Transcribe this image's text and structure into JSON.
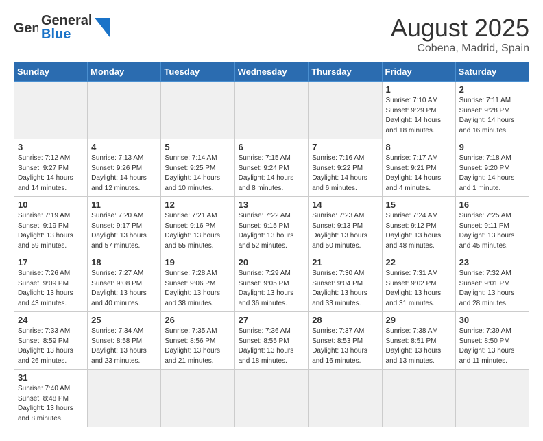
{
  "header": {
    "logo_general": "General",
    "logo_blue": "Blue",
    "month_title": "August 2025",
    "subtitle": "Cobena, Madrid, Spain"
  },
  "weekdays": [
    "Sunday",
    "Monday",
    "Tuesday",
    "Wednesday",
    "Thursday",
    "Friday",
    "Saturday"
  ],
  "weeks": [
    [
      {
        "day": "",
        "info": ""
      },
      {
        "day": "",
        "info": ""
      },
      {
        "day": "",
        "info": ""
      },
      {
        "day": "",
        "info": ""
      },
      {
        "day": "",
        "info": ""
      },
      {
        "day": "1",
        "info": "Sunrise: 7:10 AM\nSunset: 9:29 PM\nDaylight: 14 hours and 18 minutes."
      },
      {
        "day": "2",
        "info": "Sunrise: 7:11 AM\nSunset: 9:28 PM\nDaylight: 14 hours and 16 minutes."
      }
    ],
    [
      {
        "day": "3",
        "info": "Sunrise: 7:12 AM\nSunset: 9:27 PM\nDaylight: 14 hours and 14 minutes."
      },
      {
        "day": "4",
        "info": "Sunrise: 7:13 AM\nSunset: 9:26 PM\nDaylight: 14 hours and 12 minutes."
      },
      {
        "day": "5",
        "info": "Sunrise: 7:14 AM\nSunset: 9:25 PM\nDaylight: 14 hours and 10 minutes."
      },
      {
        "day": "6",
        "info": "Sunrise: 7:15 AM\nSunset: 9:24 PM\nDaylight: 14 hours and 8 minutes."
      },
      {
        "day": "7",
        "info": "Sunrise: 7:16 AM\nSunset: 9:22 PM\nDaylight: 14 hours and 6 minutes."
      },
      {
        "day": "8",
        "info": "Sunrise: 7:17 AM\nSunset: 9:21 PM\nDaylight: 14 hours and 4 minutes."
      },
      {
        "day": "9",
        "info": "Sunrise: 7:18 AM\nSunset: 9:20 PM\nDaylight: 14 hours and 1 minute."
      }
    ],
    [
      {
        "day": "10",
        "info": "Sunrise: 7:19 AM\nSunset: 9:19 PM\nDaylight: 13 hours and 59 minutes."
      },
      {
        "day": "11",
        "info": "Sunrise: 7:20 AM\nSunset: 9:17 PM\nDaylight: 13 hours and 57 minutes."
      },
      {
        "day": "12",
        "info": "Sunrise: 7:21 AM\nSunset: 9:16 PM\nDaylight: 13 hours and 55 minutes."
      },
      {
        "day": "13",
        "info": "Sunrise: 7:22 AM\nSunset: 9:15 PM\nDaylight: 13 hours and 52 minutes."
      },
      {
        "day": "14",
        "info": "Sunrise: 7:23 AM\nSunset: 9:13 PM\nDaylight: 13 hours and 50 minutes."
      },
      {
        "day": "15",
        "info": "Sunrise: 7:24 AM\nSunset: 9:12 PM\nDaylight: 13 hours and 48 minutes."
      },
      {
        "day": "16",
        "info": "Sunrise: 7:25 AM\nSunset: 9:11 PM\nDaylight: 13 hours and 45 minutes."
      }
    ],
    [
      {
        "day": "17",
        "info": "Sunrise: 7:26 AM\nSunset: 9:09 PM\nDaylight: 13 hours and 43 minutes."
      },
      {
        "day": "18",
        "info": "Sunrise: 7:27 AM\nSunset: 9:08 PM\nDaylight: 13 hours and 40 minutes."
      },
      {
        "day": "19",
        "info": "Sunrise: 7:28 AM\nSunset: 9:06 PM\nDaylight: 13 hours and 38 minutes."
      },
      {
        "day": "20",
        "info": "Sunrise: 7:29 AM\nSunset: 9:05 PM\nDaylight: 13 hours and 36 minutes."
      },
      {
        "day": "21",
        "info": "Sunrise: 7:30 AM\nSunset: 9:04 PM\nDaylight: 13 hours and 33 minutes."
      },
      {
        "day": "22",
        "info": "Sunrise: 7:31 AM\nSunset: 9:02 PM\nDaylight: 13 hours and 31 minutes."
      },
      {
        "day": "23",
        "info": "Sunrise: 7:32 AM\nSunset: 9:01 PM\nDaylight: 13 hours and 28 minutes."
      }
    ],
    [
      {
        "day": "24",
        "info": "Sunrise: 7:33 AM\nSunset: 8:59 PM\nDaylight: 13 hours and 26 minutes."
      },
      {
        "day": "25",
        "info": "Sunrise: 7:34 AM\nSunset: 8:58 PM\nDaylight: 13 hours and 23 minutes."
      },
      {
        "day": "26",
        "info": "Sunrise: 7:35 AM\nSunset: 8:56 PM\nDaylight: 13 hours and 21 minutes."
      },
      {
        "day": "27",
        "info": "Sunrise: 7:36 AM\nSunset: 8:55 PM\nDaylight: 13 hours and 18 minutes."
      },
      {
        "day": "28",
        "info": "Sunrise: 7:37 AM\nSunset: 8:53 PM\nDaylight: 13 hours and 16 minutes."
      },
      {
        "day": "29",
        "info": "Sunrise: 7:38 AM\nSunset: 8:51 PM\nDaylight: 13 hours and 13 minutes."
      },
      {
        "day": "30",
        "info": "Sunrise: 7:39 AM\nSunset: 8:50 PM\nDaylight: 13 hours and 11 minutes."
      }
    ],
    [
      {
        "day": "31",
        "info": "Sunrise: 7:40 AM\nSunset: 8:48 PM\nDaylight: 13 hours and 8 minutes."
      },
      {
        "day": "",
        "info": ""
      },
      {
        "day": "",
        "info": ""
      },
      {
        "day": "",
        "info": ""
      },
      {
        "day": "",
        "info": ""
      },
      {
        "day": "",
        "info": ""
      },
      {
        "day": "",
        "info": ""
      }
    ]
  ]
}
